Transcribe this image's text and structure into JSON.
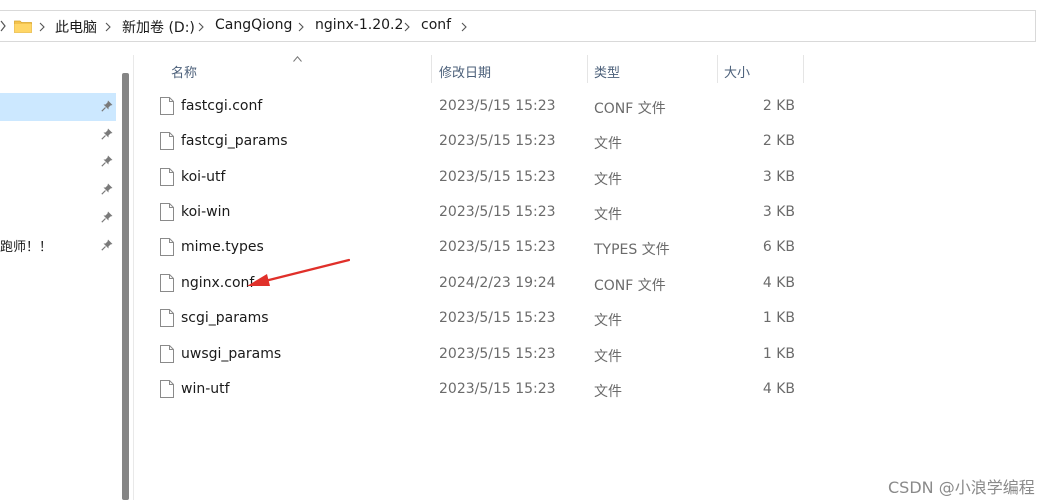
{
  "breadcrumb": {
    "items": [
      "此电脑",
      "新加卷 (D:)",
      "CangQiong",
      "nginx-1.20.2",
      "conf"
    ]
  },
  "nav": {
    "partial_text": "跑师！！"
  },
  "columns": {
    "name": "名称",
    "date": "修改日期",
    "type": "类型",
    "size": "大小"
  },
  "files": [
    {
      "name": "fastcgi.conf",
      "date": "2023/5/15 15:23",
      "type": "CONF 文件",
      "size": "2 KB"
    },
    {
      "name": "fastcgi_params",
      "date": "2023/5/15 15:23",
      "type": "文件",
      "size": "2 KB"
    },
    {
      "name": "koi-utf",
      "date": "2023/5/15 15:23",
      "type": "文件",
      "size": "3 KB"
    },
    {
      "name": "koi-win",
      "date": "2023/5/15 15:23",
      "type": "文件",
      "size": "3 KB"
    },
    {
      "name": "mime.types",
      "date": "2023/5/15 15:23",
      "type": "TYPES 文件",
      "size": "6 KB"
    },
    {
      "name": "nginx.conf",
      "date": "2024/2/23 19:24",
      "type": "CONF 文件",
      "size": "4 KB"
    },
    {
      "name": "scgi_params",
      "date": "2023/5/15 15:23",
      "type": "文件",
      "size": "1 KB"
    },
    {
      "name": "uwsgi_params",
      "date": "2023/5/15 15:23",
      "type": "文件",
      "size": "1 KB"
    },
    {
      "name": "win-utf",
      "date": "2023/5/15 15:23",
      "type": "文件",
      "size": "4 KB"
    }
  ],
  "watermark": "CSDN @小浪学编程",
  "colors": {
    "selection": "#cce8ff",
    "header_text": "#4c607a",
    "annotation_arrow": "#e0302a",
    "folder": "#f3c24d"
  }
}
